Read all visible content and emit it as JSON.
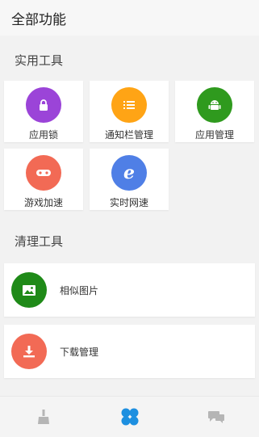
{
  "header": {
    "title": "全部功能"
  },
  "sections": {
    "tools": {
      "title": "实用工具"
    },
    "clean": {
      "title": "清理工具"
    }
  },
  "tools": [
    {
      "label": "应用锁",
      "icon": "lock-icon",
      "color": "#9b44d8"
    },
    {
      "label": "通知栏管理",
      "icon": "list-icon",
      "color": "#ffa415"
    },
    {
      "label": "应用管理",
      "icon": "android-icon",
      "color": "#2f9a1e"
    },
    {
      "label": "游戏加速",
      "icon": "gamepad-icon",
      "color": "#f26a55"
    },
    {
      "label": "实时网速",
      "icon": "ie-icon",
      "color": "#4f7fe6"
    }
  ],
  "clean_tools": [
    {
      "label": "相似图片",
      "icon": "image-icon",
      "color": "#1f8a18"
    },
    {
      "label": "下载管理",
      "icon": "download-icon",
      "color": "#f26a55"
    }
  ],
  "tabbar": {
    "items": [
      {
        "icon": "broom-icon",
        "color": "#b5b5b5",
        "active": false
      },
      {
        "icon": "clover-icon",
        "color": "#1d8fe0",
        "active": true
      },
      {
        "icon": "chat-icon",
        "color": "#b5b5b5",
        "active": false
      }
    ]
  }
}
